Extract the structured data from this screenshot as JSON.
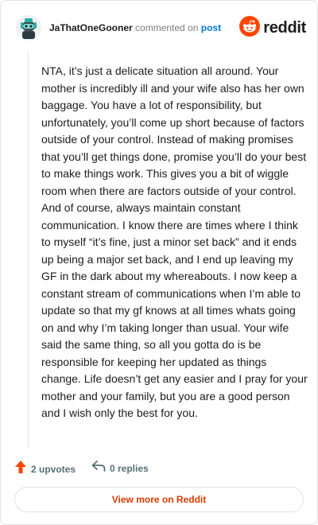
{
  "header": {
    "username": "JaThatOneGooner",
    "action_text": "commented on",
    "post_link": "post",
    "brand": "reddit"
  },
  "comment": {
    "text": "NTA, it’s just a delicate situation all around. Your mother is incredibly ill and your wife also has her own baggage. You have a lot of responsibility, but unfortunately, you’ll come up short because of factors outside of your control. Instead of making promises that you’ll get things done, promise you’ll do your best to make things work. This gives you a bit of wiggle room when there are factors outside of your control. And of course, always maintain constant communication. I know there are times where I think to myself “it’s fine, just a minor set back” and it ends up being a major set back, and I end up leaving my GF in the dark about my whereabouts. I now keep a constant stream of communications when I’m able to update so that my gf knows at all times whats going on and why I’m taking longer than usual. Your wife said the same thing, so all you gotta do is be responsible for keeping her updated as things change. Life doesn’t get any easier and I pray for your mother and your family, but you are a good person and I wish only the best for you."
  },
  "actions": {
    "upvotes_label": "2 upvotes",
    "replies_label": "0 replies"
  },
  "footer": {
    "view_more_label": "View more on Reddit"
  },
  "colors": {
    "brand_orange": "#ff4500",
    "link_blue": "#0079d3",
    "view_more_text": "#d93a00",
    "action_gray": "#576f76"
  },
  "icons": {
    "avatar": "robot-avatar-icon",
    "logo": "reddit-snoo-icon",
    "upvote": "upvote-arrow-icon",
    "reply": "reply-arrow-icon"
  }
}
